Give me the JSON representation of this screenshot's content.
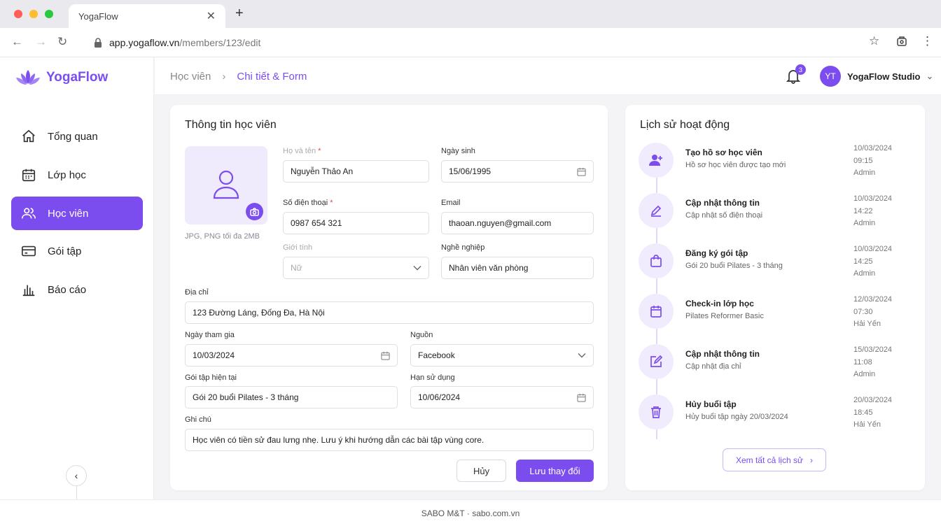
{
  "browser": {
    "tab_title": "YogaFlow",
    "url_host": "app.yogaflow.vn",
    "url_path": "/members/123/edit"
  },
  "brand": {
    "name": "YogaFlow",
    "accent": "#7c4dee"
  },
  "sidebar": {
    "items": [
      {
        "label": "Tổng quan",
        "icon": "home-icon"
      },
      {
        "label": "Lớp học",
        "icon": "calendar-icon"
      },
      {
        "label": "Học viên",
        "icon": "users-icon",
        "active": true
      },
      {
        "label": "Gói tập",
        "icon": "ticket-icon"
      },
      {
        "label": "Báo cáo",
        "icon": "bar-chart-icon"
      }
    ]
  },
  "header": {
    "breadcrumb_parent": "Học viên",
    "breadcrumb_current": "Chi tiết & Form",
    "notification_count": "3",
    "user_initials": "YT",
    "user_name": "YogaFlow Studio"
  },
  "form": {
    "title": "Thông tin học viên",
    "photo_hint": "JPG, PNG tối đa 2MB",
    "name_label": "Họ và tên",
    "name_value": "Nguyễn Thảo An",
    "dob_label": "Ngày sinh",
    "dob_value": "15/06/1995",
    "phone_label": "Số điện thoại",
    "phone_value": "0987 654 321",
    "email_label": "Email",
    "email_value": "thaoan.nguyen@gmail.com",
    "gender_label": "Giới tính",
    "gender_value": "Nữ",
    "job_label": "Nghề nghiệp",
    "job_value": "Nhân viên văn phòng",
    "address_label": "Địa chỉ",
    "address_value": "123 Đường Láng, Đống Đa, Hà Nội",
    "join_label": "Ngày tham gia",
    "join_value": "10/03/2024",
    "source_label": "Nguồn",
    "source_value": "Facebook",
    "package_label": "Gói tập hiện tại",
    "package_value": "Gói 20 buổi Pilates - 3 tháng",
    "expiry_label": "Hạn sử dụng",
    "expiry_value": "10/06/2024",
    "note_label": "Ghi chú",
    "note_value": "Học viên có tiền sử đau lưng nhẹ. Lưu ý khi hướng dẫn các bài tập vùng core.",
    "cancel_label": "Hủy",
    "save_label": "Lưu thay đổi"
  },
  "history": {
    "title": "Lịch sử hoạt động",
    "items": [
      {
        "title": "Tạo hồ sơ học viên",
        "sub": "Hồ sơ học viên được tạo mới",
        "date": "10/03/2024",
        "time": "09:15",
        "by": "Admin",
        "icon": "user-plus-icon"
      },
      {
        "title": "Cập nhật thông tin",
        "sub": "Cập nhật số điện thoại",
        "date": "10/03/2024",
        "time": "14:22",
        "by": "Admin",
        "icon": "pencil-icon"
      },
      {
        "title": "Đăng ký gói tập",
        "sub": "Gói 20 buổi Pilates - 3 tháng",
        "date": "10/03/2024",
        "time": "14:25",
        "by": "Admin",
        "icon": "shopping-bag-icon"
      },
      {
        "title": "Check-in lớp học",
        "sub": "Pilates Reformer Basic",
        "date": "12/03/2024",
        "time": "07:30",
        "by": "Hải Yến",
        "icon": "calendar-icon"
      },
      {
        "title": "Cập nhật thông tin",
        "sub": "Cập nhật địa chỉ",
        "date": "15/03/2024",
        "time": "11:08",
        "by": "Admin",
        "icon": "edit-square-icon"
      },
      {
        "title": "Hủy buổi tập",
        "sub": "Hủy buổi tập ngày 20/03/2024",
        "date": "20/03/2024",
        "time": "18:45",
        "by": "Hải Yến",
        "icon": "trash-icon"
      }
    ],
    "more_label": "Xem tất cả lịch sử"
  },
  "footer": {
    "text": "SABO M&T · sabo.com.vn"
  }
}
